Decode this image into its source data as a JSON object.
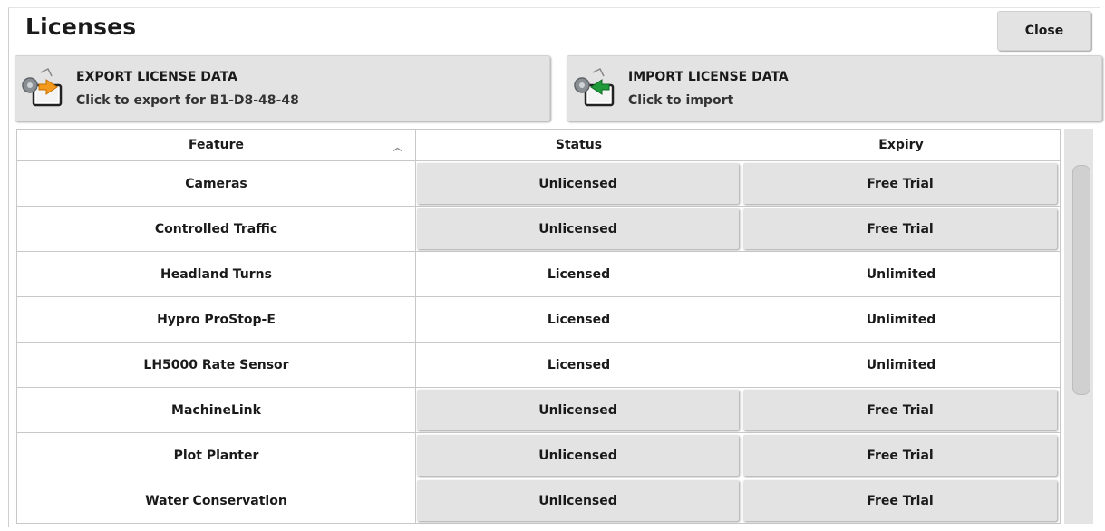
{
  "header": {
    "title": "Licenses",
    "close_label": "Close"
  },
  "actions": {
    "export": {
      "title": "EXPORT LICENSE DATA",
      "subtitle": "Click to export for B1-D8-48-48",
      "icon": "export-license-icon",
      "arrow_color": "#f39a1e"
    },
    "import": {
      "title": "IMPORT LICENSE DATA",
      "subtitle": "Click to import",
      "icon": "import-license-icon",
      "arrow_color": "#1e9a3a"
    }
  },
  "table": {
    "columns": [
      "Feature",
      "Status",
      "Expiry"
    ],
    "sort_column": "Feature",
    "sort_direction": "ascending",
    "rows": [
      {
        "feature": "Cameras",
        "status": "Unlicensed",
        "expiry": "Free Trial",
        "actionable": true
      },
      {
        "feature": "Controlled Traffic",
        "status": "Unlicensed",
        "expiry": "Free Trial",
        "actionable": true
      },
      {
        "feature": "Headland Turns",
        "status": "Licensed",
        "expiry": "Unlimited",
        "actionable": false
      },
      {
        "feature": "Hypro ProStop-E",
        "status": "Licensed",
        "expiry": "Unlimited",
        "actionable": false
      },
      {
        "feature": "LH5000 Rate Sensor",
        "status": "Licensed",
        "expiry": "Unlimited",
        "actionable": false
      },
      {
        "feature": "MachineLink",
        "status": "Unlicensed",
        "expiry": "Free Trial",
        "actionable": true
      },
      {
        "feature": "Plot Planter",
        "status": "Unlicensed",
        "expiry": "Free Trial",
        "actionable": true
      },
      {
        "feature": "Water Conservation",
        "status": "Unlicensed",
        "expiry": "Free Trial",
        "actionable": true
      }
    ]
  },
  "colors": {
    "button_bg": "#e3e3e3",
    "border": "#c8c8c8",
    "text": "#1a1a1a"
  }
}
